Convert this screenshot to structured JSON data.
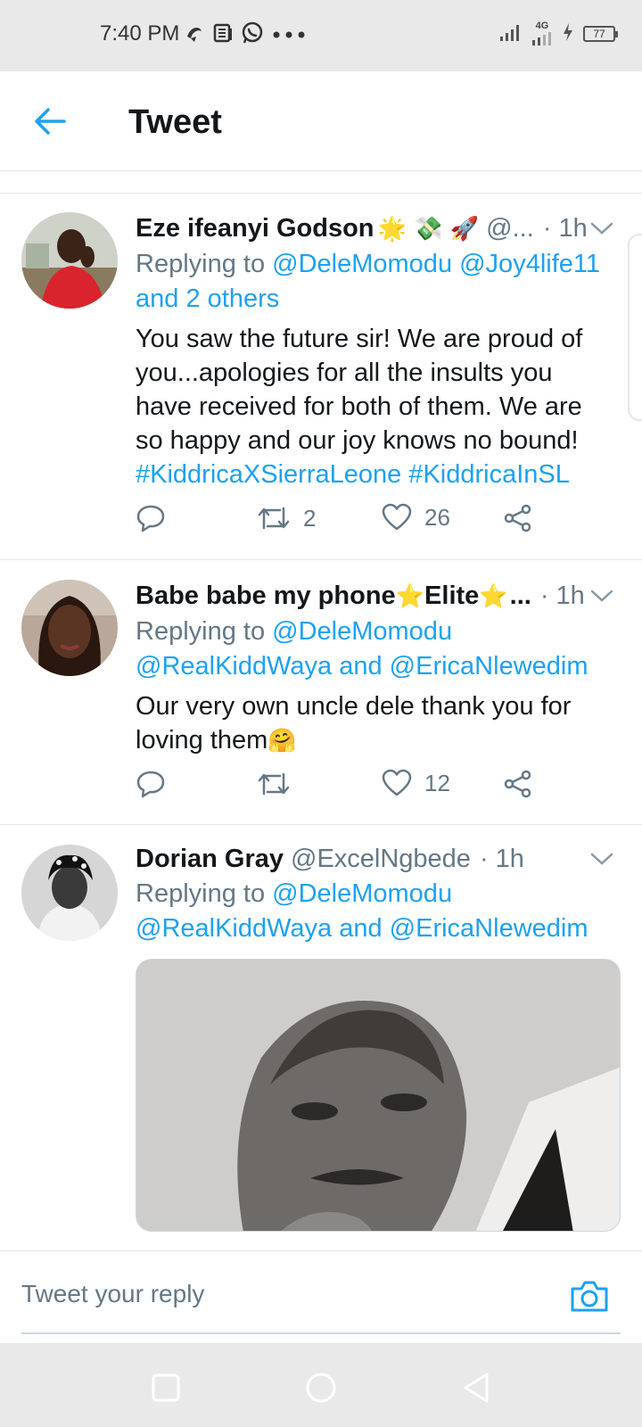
{
  "status_bar": {
    "time": "7:40 PM",
    "network": "4G",
    "battery": "77",
    "left_icons": [
      "signal-app-icon",
      "news-icon",
      "whatsapp-icon",
      "more-dots-icon"
    ]
  },
  "header": {
    "title": "Tweet"
  },
  "tweets": [
    {
      "name": "Eze ifeanyi Godson",
      "name_emoji": "🌟 💸 🚀",
      "handle": "@...",
      "time": "· 1h",
      "replying_prefix": "Replying to ",
      "replying_mentions": "@DeleMomodu @Joy4life11 and 2 others",
      "text": "You saw the future sir! We are proud of you...apologies for all the insults you have received for both of them. We are so happy and our joy knows no bound!",
      "hashtags": "#KiddricaXSierraLeone #KiddricaInSL",
      "retweets": "2",
      "likes": "26"
    },
    {
      "name": "Babe babe my phone",
      "name_emoji_1": "⭐",
      "name_mid": "Elite",
      "name_emoji_2": "⭐",
      "name_tail": "...",
      "time": "· 1h",
      "replying_prefix": "Replying to ",
      "replying_mention_1": "@DeleMomodu",
      "replying_mention_2": "@RealKiddWaya and @EricaNlewedim",
      "text": "Our very own uncle dele thank you for loving them",
      "text_emoji": "🤗",
      "retweets": "",
      "likes": "12"
    },
    {
      "name": "Dorian Gray",
      "handle": "@ExcelNgbede",
      "time": "· 1h",
      "replying_prefix": "Replying to ",
      "replying_mention_1": "@DeleMomodu",
      "replying_mention_2": "@RealKiddWaya and @EricaNlewedim"
    }
  ],
  "reply": {
    "placeholder": "Tweet your reply"
  },
  "colors": {
    "accent": "#1da1f2",
    "secondary_text": "#657786",
    "primary_text": "#14171a",
    "divider": "#e1e8ed"
  }
}
